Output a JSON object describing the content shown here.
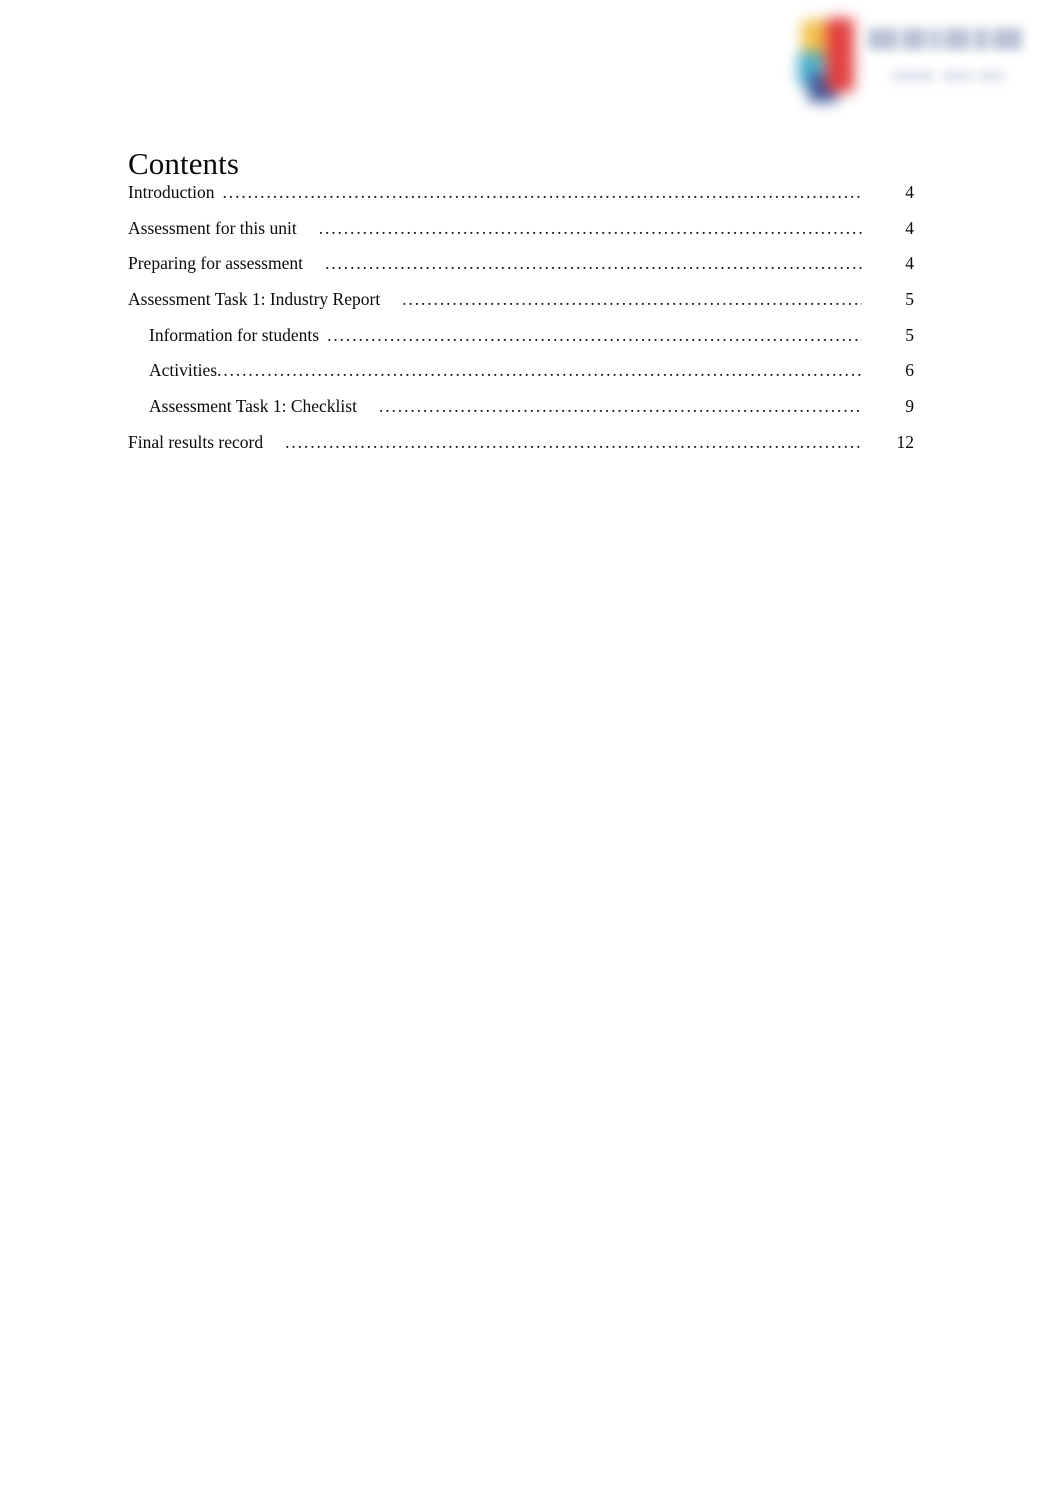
{
  "document": {
    "heading": "Contents"
  },
  "logo": {
    "mark_colors": {
      "yellow": "#f0bb3c",
      "red": "#e03030",
      "cyan": "#3ca8c8",
      "navy": "#2f4f96"
    },
    "wordmark_color": "#7f93b4"
  },
  "toc": {
    "entries": [
      {
        "title": "Introduction",
        "page": "4",
        "level": 1,
        "gap": "normal",
        "leader_width": 707
      },
      {
        "title": "Assessment for this unit",
        "page": "4",
        "level": 1,
        "gap": "wide",
        "leader_width": 720
      },
      {
        "title": "Preparing for assessment",
        "page": "4",
        "level": 1,
        "gap": "wide",
        "leader_width": 720
      },
      {
        "title": "Assessment Task 1: Industry Report",
        "page": "5",
        "level": 1,
        "gap": "wide",
        "leader_width": 729
      },
      {
        "title": "Information for students",
        "page": "5",
        "level": 2,
        "gap": "normal",
        "leader_width": 720
      },
      {
        "title": "Activities",
        "page": "6",
        "level": 2,
        "gap": "none",
        "leader_width": 710
      },
      {
        "title": "Assessment Task 1: Checklist",
        "page": "9",
        "level": 2,
        "gap": "wide",
        "leader_width": 726
      },
      {
        "title": "Final results record",
        "page": "12",
        "level": 1,
        "gap": "wide",
        "leader_width": 702
      }
    ],
    "leader_character": "."
  }
}
